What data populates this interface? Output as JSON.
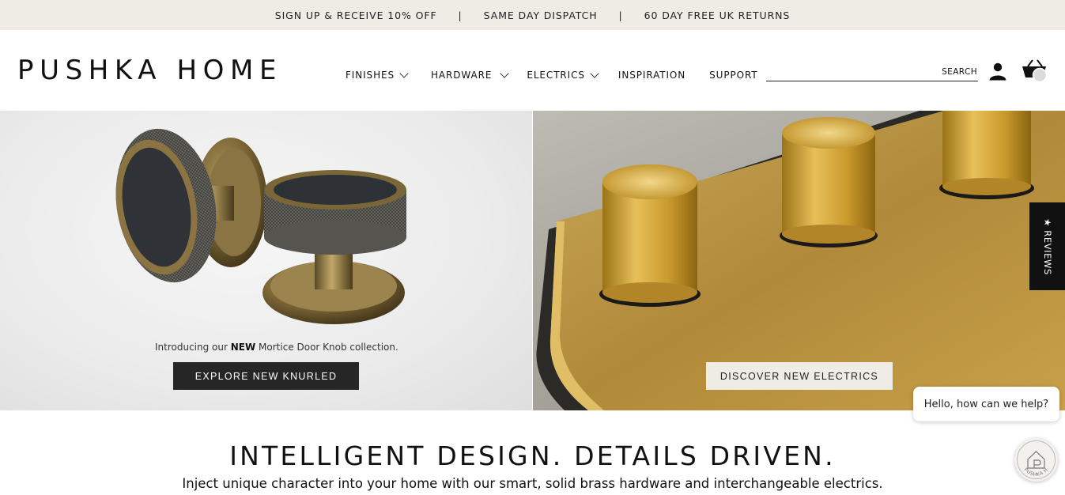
{
  "announcement": {
    "items": [
      "SIGN UP & RECEIVE 10% OFF",
      "SAME DAY DISPATCH",
      "60 DAY FREE UK RETURNS"
    ],
    "separator": "|"
  },
  "header": {
    "logo": "PUSHKA HOME",
    "nav": [
      {
        "label": "FINISHES",
        "dropdown": true
      },
      {
        "label": "HARDWARE",
        "dropdown": true
      },
      {
        "label": "ELECTRICS",
        "dropdown": true
      },
      {
        "label": "INSPIRATION",
        "dropdown": false
      },
      {
        "label": "SUPPORT",
        "dropdown": false
      }
    ],
    "search": {
      "label": "SEARCH",
      "placeholder": ""
    },
    "icons": {
      "account": "user-icon",
      "cart": "basket-icon"
    }
  },
  "hero": {
    "left": {
      "intro_prefix": "Introducing our ",
      "intro_bold": "NEW",
      "intro_suffix": " Mortice Door Knob collection.",
      "cta": "EXPLORE NEW KNURLED"
    },
    "right": {
      "cta": "DISCOVER NEW ELECTRICS"
    }
  },
  "reviews_tab": "★ REVIEWS",
  "chat": {
    "prompt": "Hello, how can we help?",
    "badge_text": "PUSHKA HOME"
  },
  "tagline": {
    "headline": "INTELLIGENT DESIGN. DETAILS DRIVEN.",
    "sub": "Inject unique character into your home with our smart, solid brass hardware and interchangeable electrics."
  },
  "colors": {
    "announcement_bg": "#efece6",
    "dark_button": "#262626",
    "light_button": "#efece6",
    "brass": "#c9a63a"
  }
}
